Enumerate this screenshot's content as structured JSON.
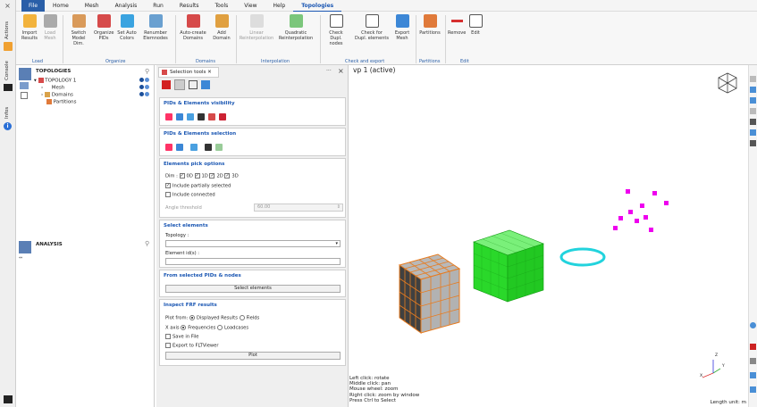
{
  "left_strip": {
    "labels": [
      "Actions",
      "Console",
      "Infos"
    ]
  },
  "menu": {
    "items": [
      "File",
      "Home",
      "Mesh",
      "Analysis",
      "Run",
      "Results",
      "Tools",
      "View",
      "Help",
      "Topologies"
    ],
    "active": "Topologies"
  },
  "ribbon": {
    "buttons": [
      {
        "l1": "Import",
        "l2": "Results"
      },
      {
        "l1": "Load",
        "l2": "Mesh"
      },
      {
        "l1": "Switch",
        "l2": "Model Dim."
      },
      {
        "l1": "Organize",
        "l2": "PIDs"
      },
      {
        "l1": "Set Auto",
        "l2": "Colors"
      },
      {
        "l1": "Renumber",
        "l2": "Elemnodes"
      },
      {
        "l1": "Auto-create",
        "l2": "Domains"
      },
      {
        "l1": "Add",
        "l2": "Domain"
      },
      {
        "l1": "Linear",
        "l2": "Reinterpolation"
      },
      {
        "l1": "Quadratic",
        "l2": "Reinterpolation"
      },
      {
        "l1": "Check",
        "l2": "Dupl. nodes"
      },
      {
        "l1": "Check for",
        "l2": "Dupl. elements"
      },
      {
        "l1": "Export",
        "l2": "Mesh"
      },
      {
        "l1": "Partitions",
        "l2": ""
      },
      {
        "l1": "Remove",
        "l2": ""
      },
      {
        "l1": "Edit",
        "l2": ""
      }
    ],
    "groups": [
      "Load",
      "Organize",
      "Domains",
      "Interpolation",
      "Check and export",
      "Partitions",
      "Edit"
    ]
  },
  "tree": {
    "title": "TOPOLOGIES",
    "items": [
      "TOPOLOGY 1",
      "Mesh",
      "Domains",
      "Partitions"
    ],
    "analysis_title": "ANALYSIS"
  },
  "panel": {
    "tab": "Selection tools",
    "s1_title": "PIDs & Elements visibility",
    "s2_title": "PIDs & Elements selection",
    "s3_title": "Elements pick options",
    "dim_label": "Dim :",
    "dims": [
      "0D",
      "1D",
      "2D",
      "3D"
    ],
    "include_partial": "Include partially selected",
    "include_connected": "Include connected",
    "angle_label": "Angle threshold",
    "angle_value": "60.00",
    "s4_title": "Select elements",
    "topology_label": "Topology :",
    "element_ids_label": "Element id(s) :",
    "s5_title": "From selected PIDs & nodes",
    "select_button": "Select elements",
    "s6_title": "Inspect FRF results",
    "plot_from": "Plot from:",
    "displayed_results": "Displayed Results",
    "fields": "Fields",
    "x_axis": "X axis",
    "frequencies": "Frequencies",
    "loadcases": "Loadcases",
    "save_in_file": "Save in File",
    "export_flt": "Export to FLTViewer",
    "plot_button": "Plot"
  },
  "viewport": {
    "title": "vp 1 (active)",
    "hints": [
      "Left click: rotate",
      "Middle click: pan",
      "Mouse wheel: zoom",
      "Right click: zoom by window",
      "Press Ctrl to Select"
    ],
    "length_unit": "Length unit: m",
    "axis_x": "X",
    "axis_y": "Y",
    "axis_z": "Z"
  },
  "colors": {
    "accent": "#1b57b3",
    "mesh_green": "#22dd22",
    "orange": "#e77b1f",
    "ring": "#22d3dd",
    "points": "#ee00ee"
  }
}
